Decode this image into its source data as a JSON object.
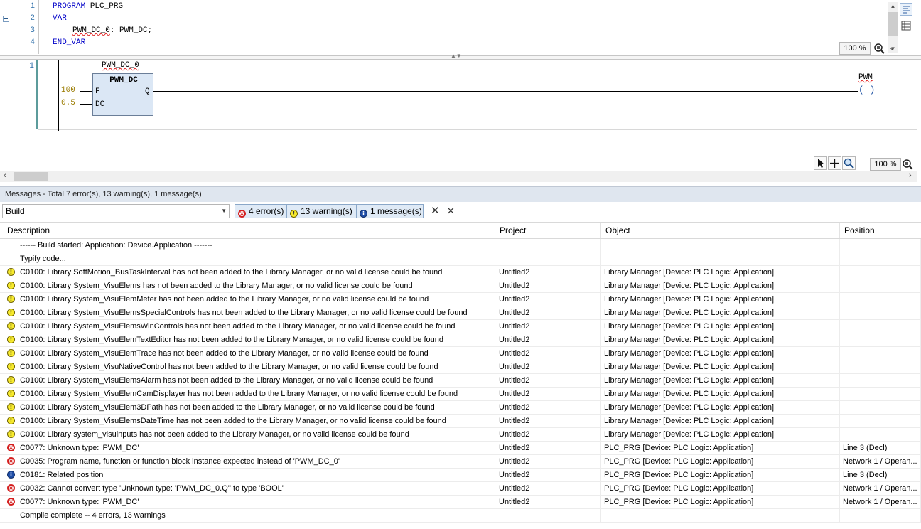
{
  "declaration": {
    "line_numbers": [
      "1",
      "2",
      "3",
      "4"
    ],
    "line1_keyword": "PROGRAM",
    "line1_name": "PLC_PRG",
    "line2_keyword": "VAR",
    "line3_var": "PWM_DC_0",
    "line3_type": ": PWM_DC;",
    "line4_keyword": "END_VAR",
    "zoom": "100 %"
  },
  "ladder": {
    "network_number": "1",
    "instance_name": "PWM_DC_0",
    "block_type": "PWM_DC",
    "inputs": [
      {
        "value": "100",
        "pin": "F"
      },
      {
        "value": "0.5",
        "pin": "DC"
      }
    ],
    "output_pin": "Q",
    "coil_name": "PWM",
    "coil_symbol": "( )",
    "zoom": "100 %"
  },
  "messages": {
    "title": "Messages - Total 7 error(s), 13 warning(s), 1 message(s)",
    "category": "Build",
    "filters": {
      "errors": "4 error(s)",
      "warnings": "13 warning(s)",
      "messages": "1 message(s)"
    },
    "columns": [
      "Description",
      "Project",
      "Object",
      "Position"
    ],
    "rows": [
      {
        "icon": "none",
        "description": "------ Build started: Application: Device.Application -------",
        "project": "",
        "object": "",
        "position": ""
      },
      {
        "icon": "none",
        "description": "Typify code...",
        "project": "",
        "object": "",
        "position": ""
      },
      {
        "icon": "warning-icon",
        "description": "C0100: Library SoftMotion_BusTaskInterval has not been added to the Library Manager, or no valid license could be found",
        "project": "Untitled2",
        "object": "Library Manager [Device: PLC Logic: Application]",
        "position": ""
      },
      {
        "icon": "warning-icon",
        "description": "C0100: Library System_VisuElems has not been added to the Library Manager, or no valid license could be found",
        "project": "Untitled2",
        "object": "Library Manager [Device: PLC Logic: Application]",
        "position": ""
      },
      {
        "icon": "warning-icon",
        "description": "C0100: Library System_VisuElemMeter has not been added to the Library Manager, or no valid license could be found",
        "project": "Untitled2",
        "object": "Library Manager [Device: PLC Logic: Application]",
        "position": ""
      },
      {
        "icon": "warning-icon",
        "description": "C0100: Library System_VisuElemsSpecialControls has not been added to the Library Manager, or no valid license could be found",
        "project": "Untitled2",
        "object": "Library Manager [Device: PLC Logic: Application]",
        "position": ""
      },
      {
        "icon": "warning-icon",
        "description": "C0100: Library System_VisuElemsWinControls has not been added to the Library Manager, or no valid license could be found",
        "project": "Untitled2",
        "object": "Library Manager [Device: PLC Logic: Application]",
        "position": ""
      },
      {
        "icon": "warning-icon",
        "description": "C0100: Library System_VisuElemTextEditor has not been added to the Library Manager, or no valid license could be found",
        "project": "Untitled2",
        "object": "Library Manager [Device: PLC Logic: Application]",
        "position": ""
      },
      {
        "icon": "warning-icon",
        "description": "C0100: Library System_VisuElemTrace has not been added to the Library Manager, or no valid license could be found",
        "project": "Untitled2",
        "object": "Library Manager [Device: PLC Logic: Application]",
        "position": ""
      },
      {
        "icon": "warning-icon",
        "description": "C0100: Library System_VisuNativeControl has not been added to the Library Manager, or no valid license could be found",
        "project": "Untitled2",
        "object": "Library Manager [Device: PLC Logic: Application]",
        "position": ""
      },
      {
        "icon": "warning-icon",
        "description": "C0100: Library System_VisuElemsAlarm has not been added to the Library Manager, or no valid license could be found",
        "project": "Untitled2",
        "object": "Library Manager [Device: PLC Logic: Application]",
        "position": ""
      },
      {
        "icon": "warning-icon",
        "description": "C0100: Library System_VisuElemCamDisplayer has not been added to the Library Manager, or no valid license could be found",
        "project": "Untitled2",
        "object": "Library Manager [Device: PLC Logic: Application]",
        "position": ""
      },
      {
        "icon": "warning-icon",
        "description": "C0100: Library System_VisuElem3DPath has not been added to the Library Manager, or no valid license could be found",
        "project": "Untitled2",
        "object": "Library Manager [Device: PLC Logic: Application]",
        "position": ""
      },
      {
        "icon": "warning-icon",
        "description": "C0100: Library System_VisuElemsDateTime has not been added to the Library Manager, or no valid license could be found",
        "project": "Untitled2",
        "object": "Library Manager [Device: PLC Logic: Application]",
        "position": ""
      },
      {
        "icon": "warning-icon",
        "description": "C0100: Library system_visuinputs has not been added to the Library Manager, or no valid license could be found",
        "project": "Untitled2",
        "object": "Library Manager [Device: PLC Logic: Application]",
        "position": ""
      },
      {
        "icon": "error-icon",
        "description": "C0077: Unknown type: 'PWM_DC'",
        "project": "Untitled2",
        "object": "PLC_PRG [Device: PLC Logic: Application]",
        "position": "Line 3 (Decl)"
      },
      {
        "icon": "error-icon",
        "description": "C0035: Program name, function or function block instance expected instead of 'PWM_DC_0'",
        "project": "Untitled2",
        "object": "PLC_PRG [Device: PLC Logic: Application]",
        "position": "Network 1 / Operan..."
      },
      {
        "icon": "info-icon",
        "description": "C0181: Related position",
        "project": "Untitled2",
        "object": "PLC_PRG [Device: PLC Logic: Application]",
        "position": "Line 3 (Decl)"
      },
      {
        "icon": "error-icon",
        "description": "C0032: Cannot convert type 'Unknown type: 'PWM_DC_0.Q'' to type 'BOOL'",
        "project": "Untitled2",
        "object": "PLC_PRG [Device: PLC Logic: Application]",
        "position": "Network 1 / Operan..."
      },
      {
        "icon": "error-icon",
        "description": "C0077: Unknown type: 'PWM_DC'",
        "project": "Untitled2",
        "object": "PLC_PRG [Device: PLC Logic: Application]",
        "position": "Network 1 / Operan..."
      },
      {
        "icon": "none",
        "description": "Compile complete -- 4 errors, 13 warnings",
        "project": "",
        "object": "",
        "position": ""
      }
    ]
  }
}
